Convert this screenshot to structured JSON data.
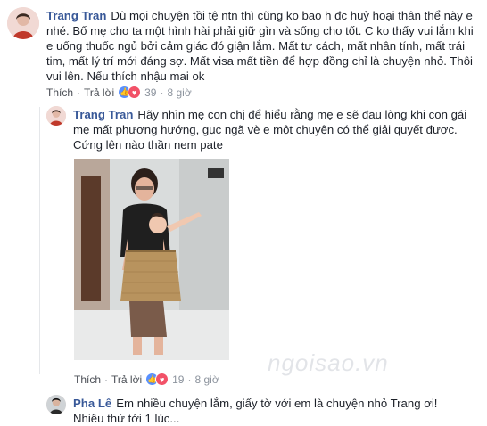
{
  "comment": {
    "author": "Trang Tran",
    "text": "Dù mọi chuyện tồi tệ ntn thì cũng ko bao h đc huỷ hoại thân thể này e nhé. Bố mẹ cho ta một hình hài phải giữ gìn và sống cho tốt. C ko thấy vui lắm khi e uống thuốc ngủ bởi cảm giác đó giận lắm. Mất tư cách, mất nhân tính, mất trái tim, mất lý trí mới đáng sợ. Mất visa mất tiền để hợp đồng chỉ là chuyện nhỏ. Thôi vui lên. Nếu thích nhậu mai ok",
    "like_label": "Thích",
    "reply_label": "Trả lời",
    "reaction_count": "39",
    "time": "8 giờ"
  },
  "reply1": {
    "author": "Trang Tran",
    "text": "Hãy nhìn mẹ con chị để hiểu rằng mẹ e sẽ đau lòng khi con gái mẹ mất phương hướng, gục ngã vè e một chuyện có thể giải quyết được. Cứng lên nào thần nem pate",
    "like_label": "Thích",
    "reply_label": "Trả lời",
    "reaction_count": "19",
    "time": "8 giờ"
  },
  "reply2": {
    "author": "Pha Lê",
    "text": "Em nhiều chuyện lắm, giấy tờ với em là chuyện nhỏ Trang ơi! Nhiều thứ tới 1 lúc..."
  },
  "watermark": "ngoisao.vn",
  "colors": {
    "author": "#385898",
    "like": "#5890ff",
    "love": "#f25268",
    "meta": "#8d949e"
  }
}
